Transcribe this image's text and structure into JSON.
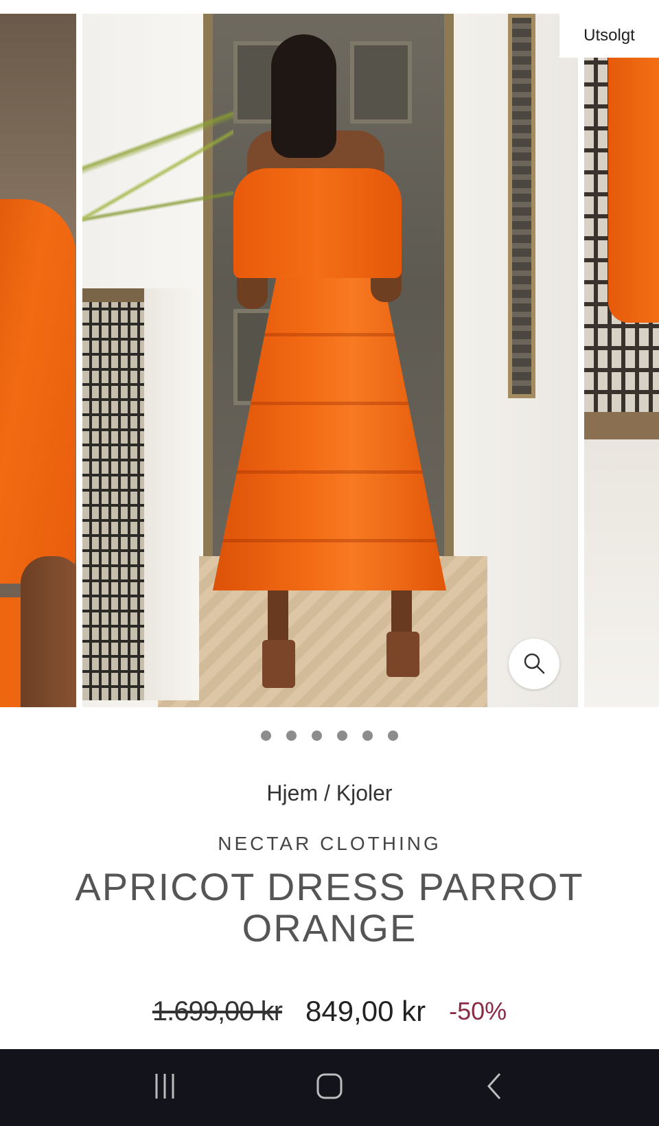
{
  "gallery": {
    "sold_badge": "Utsolgt",
    "zoom_icon": "search-icon",
    "dot_count": 6
  },
  "product": {
    "breadcrumb_home": "Hjem",
    "breadcrumb_sep": " / ",
    "breadcrumb_category": "Kjoler",
    "brand": "NECTAR CLOTHING",
    "title": "APRICOT DRESS PARROT ORANGE",
    "price_original": "1.699,00 kr",
    "price_sale": "849,00 kr",
    "discount": "-50%"
  },
  "colors": {
    "discount": "#8b2a45",
    "navbar": "#13141b"
  },
  "navbar": {
    "recent_icon": "recent-apps-icon",
    "home_icon": "home-icon",
    "back_icon": "back-icon"
  }
}
